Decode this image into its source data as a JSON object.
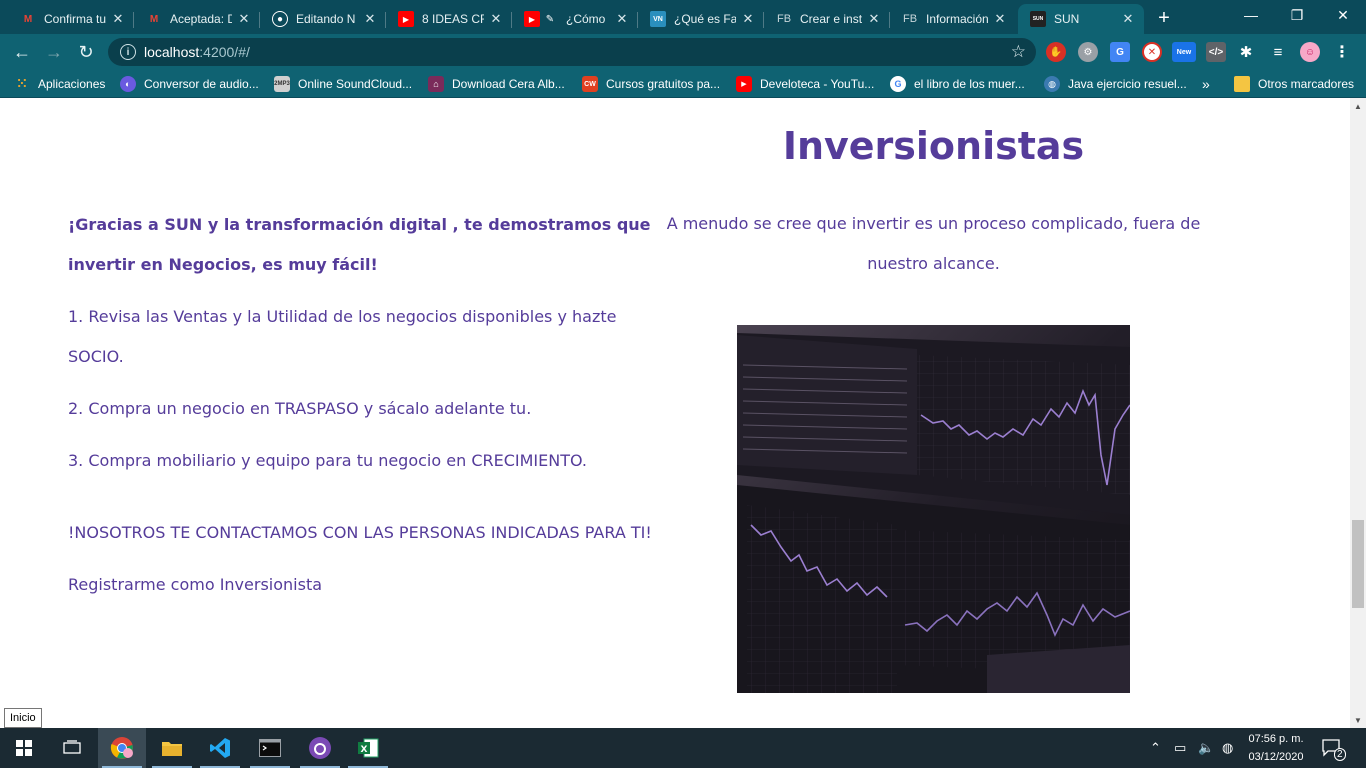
{
  "tabs": [
    {
      "title": "Confirma tu",
      "fav": "M",
      "favColor": "#ea4335",
      "favBg": "transparent"
    },
    {
      "title": "Aceptada: D",
      "fav": "M",
      "favColor": "#ea4335",
      "favBg": "transparent"
    },
    {
      "title": "Editando N",
      "fav": "◉",
      "favColor": "#ffffff",
      "favBg": "transparent"
    },
    {
      "title": "8 IDEAS CR",
      "fav": "▶",
      "favColor": "#ffffff",
      "favBg": "#ff0000"
    },
    {
      "title": "¿Cómo",
      "fav": "▶",
      "favColor": "#ffffff",
      "favBg": "#ff0000"
    },
    {
      "title": "¿Qué es Fac",
      "fav": "VN",
      "favColor": "#ffffff",
      "favBg": "#2a8fbd"
    },
    {
      "title": "Crear e inst",
      "fav": "FB",
      "favColor": "#c7d6da",
      "favBg": "transparent"
    },
    {
      "title": "Información",
      "fav": "FB",
      "favColor": "#c7d6da",
      "favBg": "transparent"
    },
    {
      "title": "SUN",
      "fav": "SUN",
      "favColor": "#ffffff",
      "favBg": "#222222"
    }
  ],
  "address": {
    "host": "localhost",
    "path": ":4200/#/"
  },
  "bookmarks": [
    {
      "label": "Aplicaciones",
      "color": "#e0a030"
    },
    {
      "label": "Conversor de audio...",
      "color": "#6a5ae0"
    },
    {
      "label": "Online SoundCloud...",
      "color": "#888888"
    },
    {
      "label": "Download Cera Alb...",
      "color": "#7a2a5a"
    },
    {
      "label": "Cursos gratuitos pa...",
      "color": "#e04020"
    },
    {
      "label": "Develoteca - YouTu...",
      "color": "#ff0000"
    },
    {
      "label": "el libro de los muer...",
      "color": "#4285f4"
    },
    {
      "label": "Java ejercicio resuel...",
      "color": "#3a7ab0"
    },
    {
      "label": "»",
      "color": "transparent"
    },
    {
      "label": "Otros marcadores",
      "color": "#f4c542"
    }
  ],
  "page": {
    "lead": "¡Gracias a SUN y la transformación digital , te demostramos que invertir en Negocios, es muy fácil!",
    "steps": [
      "1. Revisa las Ventas y la Utilidad de los negocios disponibles y hazte SOCIO.",
      "2. Compra un negocio en TRASPASO y sácalo adelante tu.",
      "3. Compra mobiliario y equipo para tu negocio en CRECIMIENTO."
    ],
    "contact": "!NOSOTROS TE CONTACTAMOS CON LAS PERSONAS INDICADAS PARA TI!",
    "register": "Registrarme como Inversionista",
    "title": "Inversionistas",
    "intro": "A menudo se cree que invertir es un proceso complicado, fuera de nuestro alcance."
  },
  "tooltip": "Inicio",
  "clock": {
    "time": "07:56 p. m.",
    "date": "03/12/2020"
  },
  "notifications": "2",
  "colors": {
    "accent": "#553c9a",
    "chrome": "#0f6272",
    "tabstrip": "#0b4a5a"
  }
}
